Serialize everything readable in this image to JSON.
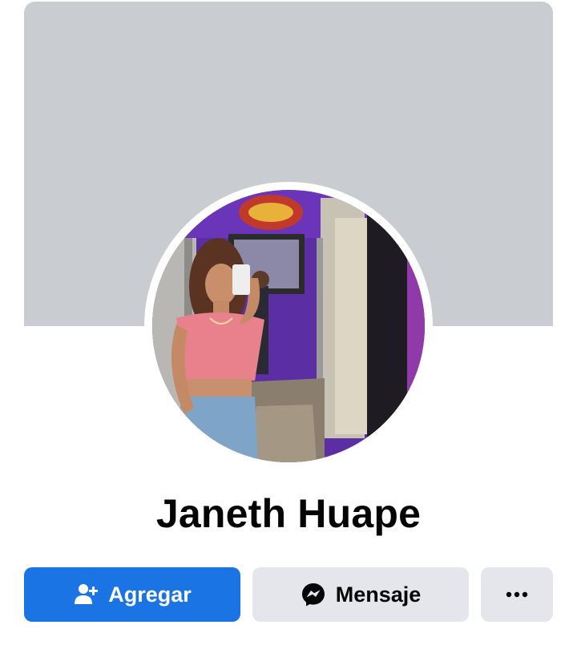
{
  "profile": {
    "name": "Janeth Huape"
  },
  "actions": {
    "add_label": "Agregar",
    "message_label": "Mensaje"
  },
  "icons": {
    "add": "add-friend-icon",
    "message": "messenger-icon",
    "more": "more-options-icon"
  },
  "colors": {
    "cover": "#c9ccd1",
    "primary": "#1b74e4",
    "secondary_button": "#e4e6eb",
    "text": "#050505"
  }
}
